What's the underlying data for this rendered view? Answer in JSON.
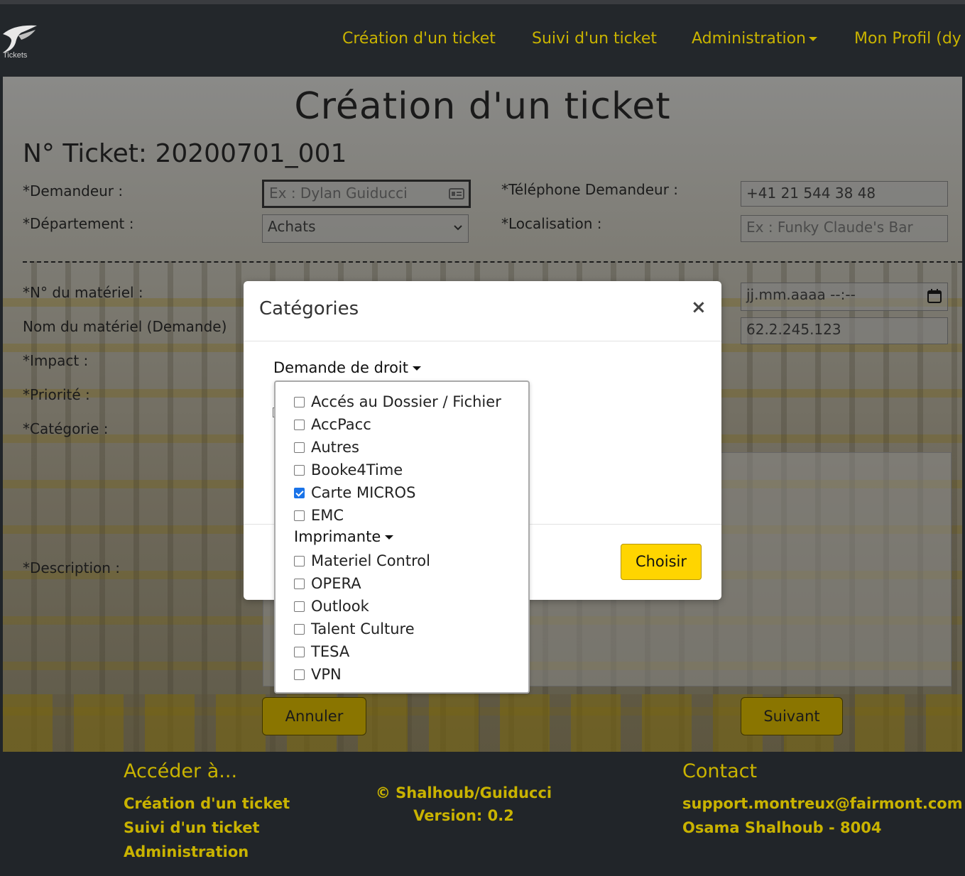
{
  "navbar": {
    "logo_text": "Tickets",
    "items": [
      {
        "label": "Création d'un ticket"
      },
      {
        "label": "Suivi d'un ticket"
      },
      {
        "label": "Administration"
      },
      {
        "label": "Mon Profil (dy"
      }
    ]
  },
  "form": {
    "page_title": "Création d'un ticket",
    "ticket_number": "N° Ticket: 20200701_001",
    "labels": {
      "demandeur": "*Demandeur :",
      "departement": "*Département :",
      "telephone": "*Téléphone Demandeur :",
      "localisation": "*Localisation :",
      "no_materiel": "*N° du matériel :",
      "nom_materiel": "Nom du matériel (Demande)",
      "impact": "*Impact :",
      "priorite": "*Priorité :",
      "categorie": "*Catégorie :",
      "description": "*Description :"
    },
    "demandeur_placeholder": "Ex : Dylan Guiducci",
    "departement_value": "Achats",
    "telephone_value": "+41 21 544 38 48",
    "localisation_placeholder": "Ex : Funky Claude's Bar",
    "datetime_placeholder": "jj.mm.aaaa --:--",
    "ip_value": "62.2.245.123",
    "cancel_label": "Annuler",
    "next_label": "Suivant"
  },
  "modal": {
    "title": "Catégories",
    "close_symbol": "×",
    "dropdown_label": "Demande de droit",
    "choose_label": "Choisir",
    "items": [
      {
        "label": "Accés au Dossier / Fichier",
        "checked": false
      },
      {
        "label": "AccPacc",
        "checked": false
      },
      {
        "label": "Autres",
        "checked": false
      },
      {
        "label": "Booke4Time",
        "checked": false
      },
      {
        "label": "Carte MICROS",
        "checked": true
      },
      {
        "label": "EMC",
        "checked": false
      }
    ],
    "submenu_label": "Imprimante",
    "items2": [
      {
        "label": "Materiel Control",
        "checked": false
      },
      {
        "label": "OPERA",
        "checked": false
      },
      {
        "label": "Outlook",
        "checked": false
      },
      {
        "label": "Talent Culture",
        "checked": false
      },
      {
        "label": "TESA",
        "checked": false
      },
      {
        "label": "VPN",
        "checked": false
      }
    ]
  },
  "footer": {
    "access_heading": "Accéder à...",
    "links": [
      "Création d'un ticket",
      "Suivi d'un ticket",
      "Administration"
    ],
    "copyright": "© Shalhoub/Guiducci",
    "version": "Version: 0.2",
    "contact_heading": "Contact",
    "email": "support.montreux@fairmont.com",
    "contact_person": "Osama Shalhoub - 8004"
  },
  "colors": {
    "accent_yellow": "#c9b300",
    "button_yellow": "#ffd500",
    "dark_bg": "#212529",
    "checkbox_blue": "#1a73e8"
  }
}
